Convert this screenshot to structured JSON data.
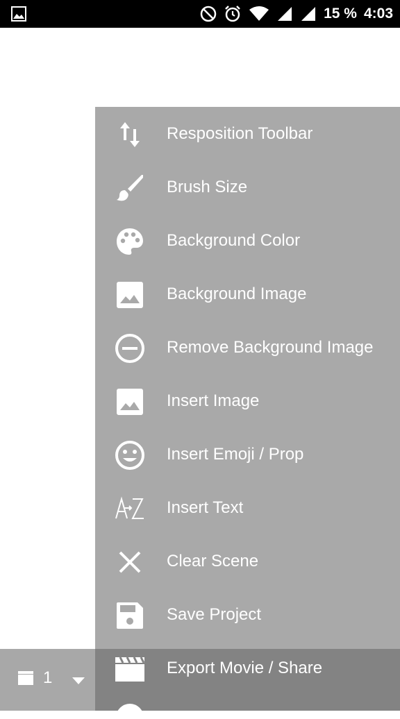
{
  "status_bar": {
    "battery_text": "15 %",
    "time": "4:03"
  },
  "menu": {
    "items": [
      {
        "label": "Resposition Toolbar",
        "icon": "reposition-arrows-icon"
      },
      {
        "label": "Brush Size",
        "icon": "brush-icon"
      },
      {
        "label": "Background Color",
        "icon": "palette-icon"
      },
      {
        "label": "Background Image",
        "icon": "image-icon"
      },
      {
        "label": "Remove Background Image",
        "icon": "remove-circle-icon"
      },
      {
        "label": "Insert Image",
        "icon": "image-icon"
      },
      {
        "label": "Insert Emoji / Prop",
        "icon": "smiley-icon"
      },
      {
        "label": "Insert Text",
        "icon": "text-az-icon"
      },
      {
        "label": "Clear Scene",
        "icon": "close-icon"
      },
      {
        "label": "Save Project",
        "icon": "save-icon"
      },
      {
        "label": "Export Movie / Share",
        "icon": "clapperboard-icon"
      }
    ]
  },
  "toolbar": {
    "scene_number": "1",
    "current_color": "#000000"
  },
  "colors": {
    "menu_background": "#a9a9a9",
    "toolbar_background": "#7a7a7a",
    "status_bar": "#000000"
  }
}
